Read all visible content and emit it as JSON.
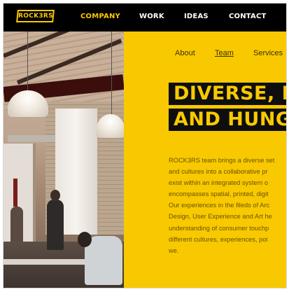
{
  "header": {
    "logo_text": "ROCK3RS",
    "nav": [
      {
        "label": "COMPANY",
        "active": true
      },
      {
        "label": "WORK",
        "active": false
      },
      {
        "label": "IDEAS",
        "active": false
      },
      {
        "label": "CONTACT",
        "active": false
      }
    ]
  },
  "subnav": [
    {
      "label": "About",
      "active": false
    },
    {
      "label": "Team",
      "active": true
    },
    {
      "label": "Services",
      "active": false
    }
  ],
  "hero": {
    "line1": "DIVERSE, EP",
    "line2": "AND HUNG"
  },
  "body_text": "ROCK3RS team brings a diverse set\nand cultures into a collaborative pr\nexist within an integrated system o\nencompasses spatial, printed, digit\nOur experiences in the fileds of Arc\nDesign, User Experience and Art he\nunderstanding of consumer touchp\ndifferent cultures, experiences, poi\nwe.",
  "colors": {
    "brand_yellow": "#f8c900",
    "nav_bg": "#000000",
    "heading_bg": "#0e0e0e",
    "body_text": "#6a5200"
  }
}
